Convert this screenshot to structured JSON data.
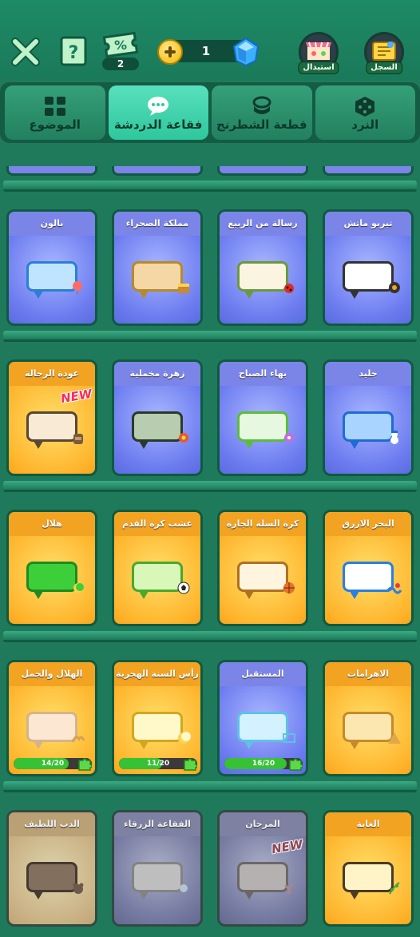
{
  "top_bar": {
    "coupon_count": "2",
    "coupon_symbol": "%",
    "gems": "1",
    "shop_label": "استبدال",
    "record_label": "السجل"
  },
  "tabs": [
    {
      "label": "الموضوع",
      "icon": "grid-icon",
      "active": false
    },
    {
      "label": "فقاعة الدردشة",
      "icon": "chat-bubble-icon",
      "active": true
    },
    {
      "label": "قطعة الشطرنج",
      "icon": "chess-piece-icon",
      "active": false
    },
    {
      "label": "النرد",
      "icon": "dice-icon",
      "active": false
    }
  ],
  "rows": [
    {
      "cards": [
        {
          "title": "بالون",
          "theme": "blue",
          "bubble_fill": "#bfe4ff",
          "bubble_border": "#2b7fd6",
          "deco": "balloon"
        },
        {
          "title": "مملكة الصحراء",
          "theme": "blue",
          "bubble_fill": "#f4d7a4",
          "bubble_border": "#b68a2c",
          "deco": "treasure"
        },
        {
          "title": "رسالة من الربيع",
          "theme": "blue",
          "bubble_fill": "#fbf4e0",
          "bubble_border": "#6b9a3c",
          "deco": "ladybug"
        },
        {
          "title": "تيربو ماتش",
          "theme": "blue",
          "bubble_fill": "#ffffff",
          "bubble_border": "#333333",
          "deco": "tire"
        }
      ]
    },
    {
      "cards": [
        {
          "title": "عودة الرحالة",
          "theme": "orange",
          "bubble_fill": "#f8ead4",
          "bubble_border": "#5a4632",
          "deco": "backpack",
          "new": "NEW"
        },
        {
          "title": "زهرة مخملية",
          "theme": "blue",
          "bubble_fill": "#b8ccb0",
          "bubble_border": "#2a3a2a",
          "deco": "flower"
        },
        {
          "title": "بهاء الصباح",
          "theme": "blue",
          "bubble_fill": "#e7f8e0",
          "bubble_border": "#5bbd3c",
          "deco": "morning-flower"
        },
        {
          "title": "جليد",
          "theme": "blue",
          "bubble_fill": "#a8d4ff",
          "bubble_border": "#1f6bd6",
          "deco": "snowman"
        }
      ]
    },
    {
      "cards": [
        {
          "title": "هلال",
          "theme": "orange",
          "bubble_fill": "#3ccf3a",
          "bubble_border": "#1f8a1e",
          "deco": "crescent"
        },
        {
          "title": "عشب كرة القدم",
          "theme": "orange",
          "bubble_fill": "#d9f7b8",
          "bubble_border": "#4aa82c",
          "deco": "soccer-ball"
        },
        {
          "title": "كرة السلة الجارة",
          "theme": "orange",
          "bubble_fill": "#fff5df",
          "bubble_border": "#b07020",
          "deco": "basketball"
        },
        {
          "title": "البحر الازرق",
          "theme": "orange",
          "bubble_fill": "#ffffff",
          "bubble_border": "#2a7fe0",
          "deco": "sea"
        }
      ]
    },
    {
      "cards": [
        {
          "title": "الهلال والجمل",
          "theme": "orange",
          "bubble_fill": "#fbe7d2",
          "bubble_border": "#d6b48a",
          "deco": "camel",
          "progress": "14/20",
          "progress_value": 0.7
        },
        {
          "title": "رأس السنة الهجرية",
          "theme": "orange",
          "bubble_fill": "#fff8c8",
          "bubble_border": "#d0a820",
          "deco": "moon",
          "progress": "11/20",
          "progress_value": 0.55
        },
        {
          "title": "المستقبل",
          "theme": "blue",
          "bubble_fill": "#d3f1ff",
          "bubble_border": "#5fc0e8",
          "deco": "future",
          "progress": "16/20",
          "progress_value": 0.8
        },
        {
          "title": "الاهرامات",
          "theme": "orange",
          "bubble_fill": "#fde7b0",
          "bubble_border": "#c68a2c",
          "deco": "pyramid"
        }
      ]
    },
    {
      "cards": [
        {
          "title": "الدب اللطيف",
          "theme": "orange",
          "bubble_fill": "#a8703c",
          "bubble_border": "#5a3a1c",
          "deco": "bear",
          "locked": true
        },
        {
          "title": "الفقاعة الزرقاء",
          "theme": "blue",
          "bubble_fill": "#c8c8c8",
          "bubble_border": "#8a8a8a",
          "deco": "blue-bubble",
          "locked": true
        },
        {
          "title": "المرجان",
          "theme": "blue",
          "bubble_fill": "#c6b9b9",
          "bubble_border": "#7a6a6a",
          "deco": "coral",
          "locked": true,
          "new": "NEW"
        },
        {
          "title": "الغابة",
          "theme": "orange",
          "bubble_fill": "#fff4c8",
          "bubble_border": "#4c3a24",
          "deco": "vine"
        }
      ]
    }
  ]
}
